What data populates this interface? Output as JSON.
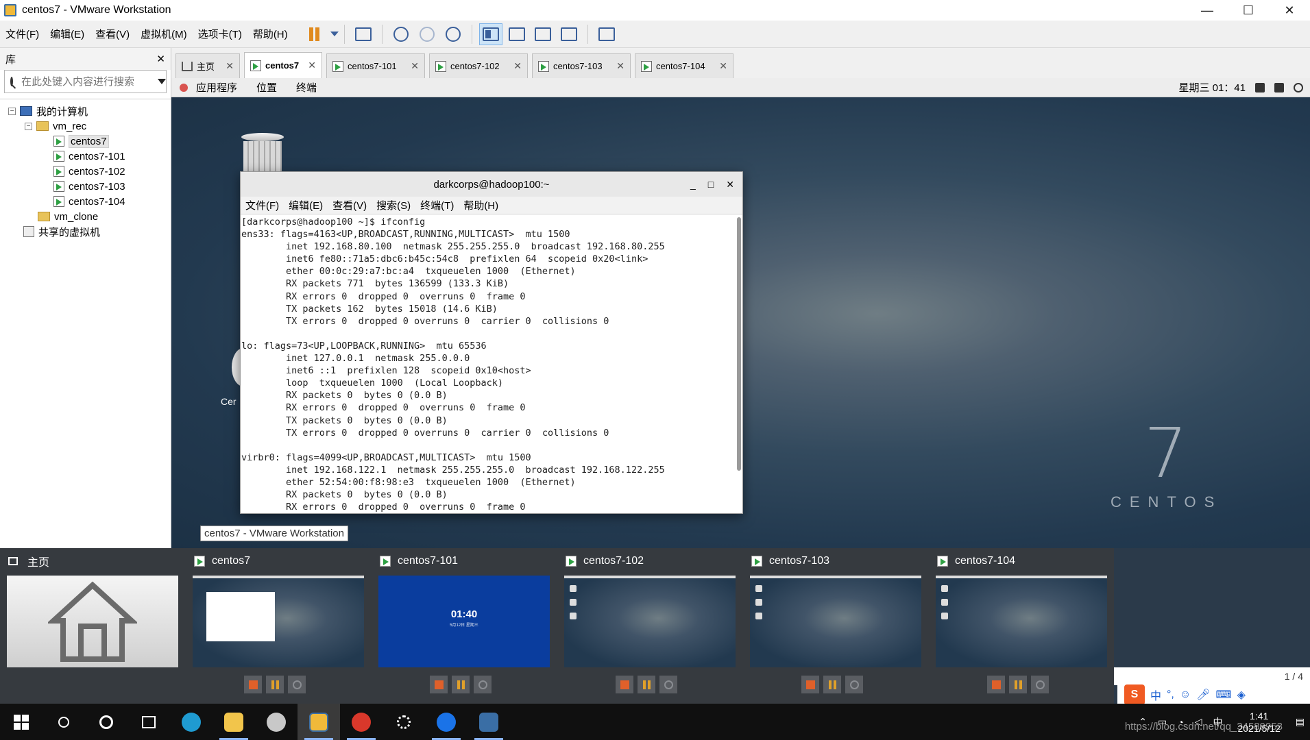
{
  "window": {
    "title": "centos7 - VMware Workstation",
    "minimize": "—",
    "maximize": "☐",
    "close": "✕"
  },
  "menubar": [
    "文件(F)",
    "编辑(E)",
    "查看(V)",
    "虚拟机(M)",
    "选项卡(T)",
    "帮助(H)"
  ],
  "library": {
    "title": "库",
    "close": "✕",
    "search_placeholder": "在此处键入内容进行搜索",
    "tree": {
      "root": "我的计算机",
      "folder1": "vm_rec",
      "vms": [
        "centos7",
        "centos7-101",
        "centos7-102",
        "centos7-103",
        "centos7-104"
      ],
      "folder2": "vm_clone",
      "shared": "共享的虚拟机"
    }
  },
  "tabs": [
    {
      "label": "主页",
      "close": "✕"
    },
    {
      "label": "centos7",
      "close": "✕"
    },
    {
      "label": "centos7-101",
      "close": "✕"
    },
    {
      "label": "centos7-102",
      "close": "✕"
    },
    {
      "label": "centos7-103",
      "close": "✕"
    },
    {
      "label": "centos7-104",
      "close": "✕"
    }
  ],
  "guest": {
    "menus": [
      "应用程序",
      "位置",
      "终端"
    ],
    "clock": "星期三 01：41",
    "desktop_partial_label": "Cer",
    "centos_seven": "7",
    "centos_word": "CENTOS"
  },
  "terminal": {
    "title": "darkcorps@hadoop100:~",
    "controls": {
      "minimize": "_",
      "maximize": "□",
      "close": "✕"
    },
    "menus": [
      "文件(F)",
      "编辑(E)",
      "查看(V)",
      "搜索(S)",
      "终端(T)",
      "帮助(H)"
    ],
    "lines": [
      "[darkcorps@hadoop100 ~]$ ifconfig",
      "ens33: flags=4163<UP,BROADCAST,RUNNING,MULTICAST>  mtu 1500",
      "        inet 192.168.80.100  netmask 255.255.255.0  broadcast 192.168.80.255",
      "        inet6 fe80::71a5:dbc6:b45c:54c8  prefixlen 64  scopeid 0x20<link>",
      "        ether 00:0c:29:a7:bc:a4  txqueuelen 1000  (Ethernet)",
      "        RX packets 771  bytes 136599 (133.3 KiB)",
      "        RX errors 0  dropped 0  overruns 0  frame 0",
      "        TX packets 162  bytes 15018 (14.6 KiB)",
      "        TX errors 0  dropped 0 overruns 0  carrier 0  collisions 0",
      "",
      "lo: flags=73<UP,LOOPBACK,RUNNING>  mtu 65536",
      "        inet 127.0.0.1  netmask 255.0.0.0",
      "        inet6 ::1  prefixlen 128  scopeid 0x10<host>",
      "        loop  txqueuelen 1000  (Local Loopback)",
      "        RX packets 0  bytes 0 (0.0 B)",
      "        RX errors 0  dropped 0  overruns 0  frame 0",
      "        TX packets 0  bytes 0 (0.0 B)",
      "        TX errors 0  dropped 0 overruns 0  carrier 0  collisions 0",
      "",
      "virbr0: flags=4099<UP,BROADCAST,MULTICAST>  mtu 1500",
      "        inet 192.168.122.1  netmask 255.255.255.0  broadcast 192.168.122.255",
      "        ether 52:54:00:f8:98:e3  txqueuelen 1000  (Ethernet)",
      "        RX packets 0  bytes 0 (0.0 B)",
      "        RX errors 0  dropped 0  overruns 0  frame 0"
    ]
  },
  "tooltip": "centos7 - VMware Workstation",
  "thumbnails": [
    {
      "label": "主页"
    },
    {
      "label": "centos7"
    },
    {
      "label": "centos7-101",
      "lock_time": "01:40",
      "lock_date": "5月12日 星期三"
    },
    {
      "label": "centos7-102"
    },
    {
      "label": "centos7-103"
    },
    {
      "label": "centos7-104"
    }
  ],
  "pager": "1 / 4",
  "ime": {
    "logo": "S",
    "lang": "中",
    "punct": "°,"
  },
  "taskbar": {
    "tray_ime": "中",
    "time": "1:41",
    "date": "2021/5/12",
    "watermark": "https://blog.csdn.net/qq_34589953"
  }
}
